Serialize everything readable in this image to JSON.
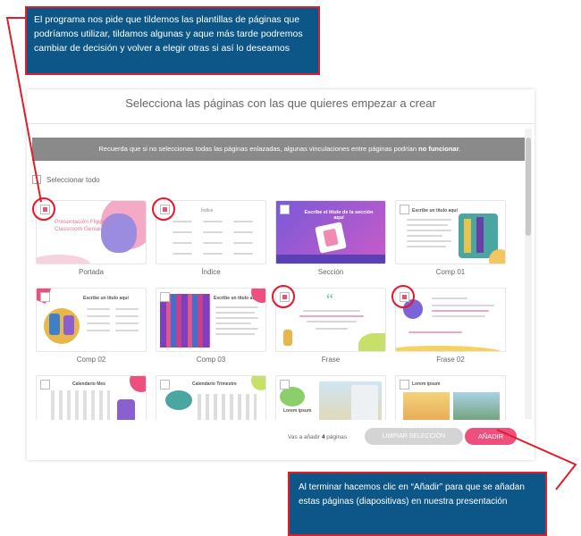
{
  "callouts": {
    "top": "El programa nos pide que tildemos las plantillas de páginas que podríamos utilizar, tildamos algunas y aque más tarde podremos cambiar de decisión y volver a elegir otras si así lo deseamos",
    "bottom": "Al terminar hacemos clic en “Añadir” para que se añadan estas páginas (diapositivas) en nuestra presentación"
  },
  "dialog": {
    "title": "Selecciona las páginas con las que quieres empezar a crear",
    "warning_text": "Recuerda que si no seleccionas todas las páginas enlazadas, algunas vinculaciones entre páginas podrían",
    "warning_bold": "no funcionar",
    "select_all": "Seleccionar todo"
  },
  "templates": [
    {
      "label": "Portada",
      "checked": true
    },
    {
      "label": "Índice",
      "checked": true
    },
    {
      "label": "Sección",
      "checked": false
    },
    {
      "label": "Comp 01",
      "checked": false
    },
    {
      "label": "Comp 02",
      "checked": false
    },
    {
      "label": "Comp 03",
      "checked": false
    },
    {
      "label": "Frase",
      "checked": true
    },
    {
      "label": "Frase 02",
      "checked": true
    },
    {
      "label": "",
      "checked": false
    },
    {
      "label": "",
      "checked": false
    },
    {
      "label": "",
      "checked": false
    },
    {
      "label": "",
      "checked": false
    }
  ],
  "thumb_text": {
    "portada": "Presentación Flipped Classroom Genial",
    "indice": "Índice",
    "seccion": "Escribe el título de la sección aquí",
    "comp01": "Escribe un título aquí",
    "comp02": "Escribe un título aquí",
    "comp03": "Escribe un título aquí",
    "frase_mark": "“",
    "calendario": "Calendario Mes",
    "calendario2": "Calendario Trimestre",
    "lorem1": "Lorem ipsum",
    "lorem2": "Lorem ipsum"
  },
  "footer": {
    "count_prefix": "Vas a añadir",
    "count_value": "4",
    "count_suffix": "páginas",
    "clear_label": "LIMPIAR SELECCIÓN",
    "add_label": "AÑADIR"
  },
  "colors": {
    "callout_bg": "#0d5688",
    "callout_border": "#e11d2b",
    "accent": "#ef4f7c",
    "warning_bg": "#8a8a8a"
  }
}
